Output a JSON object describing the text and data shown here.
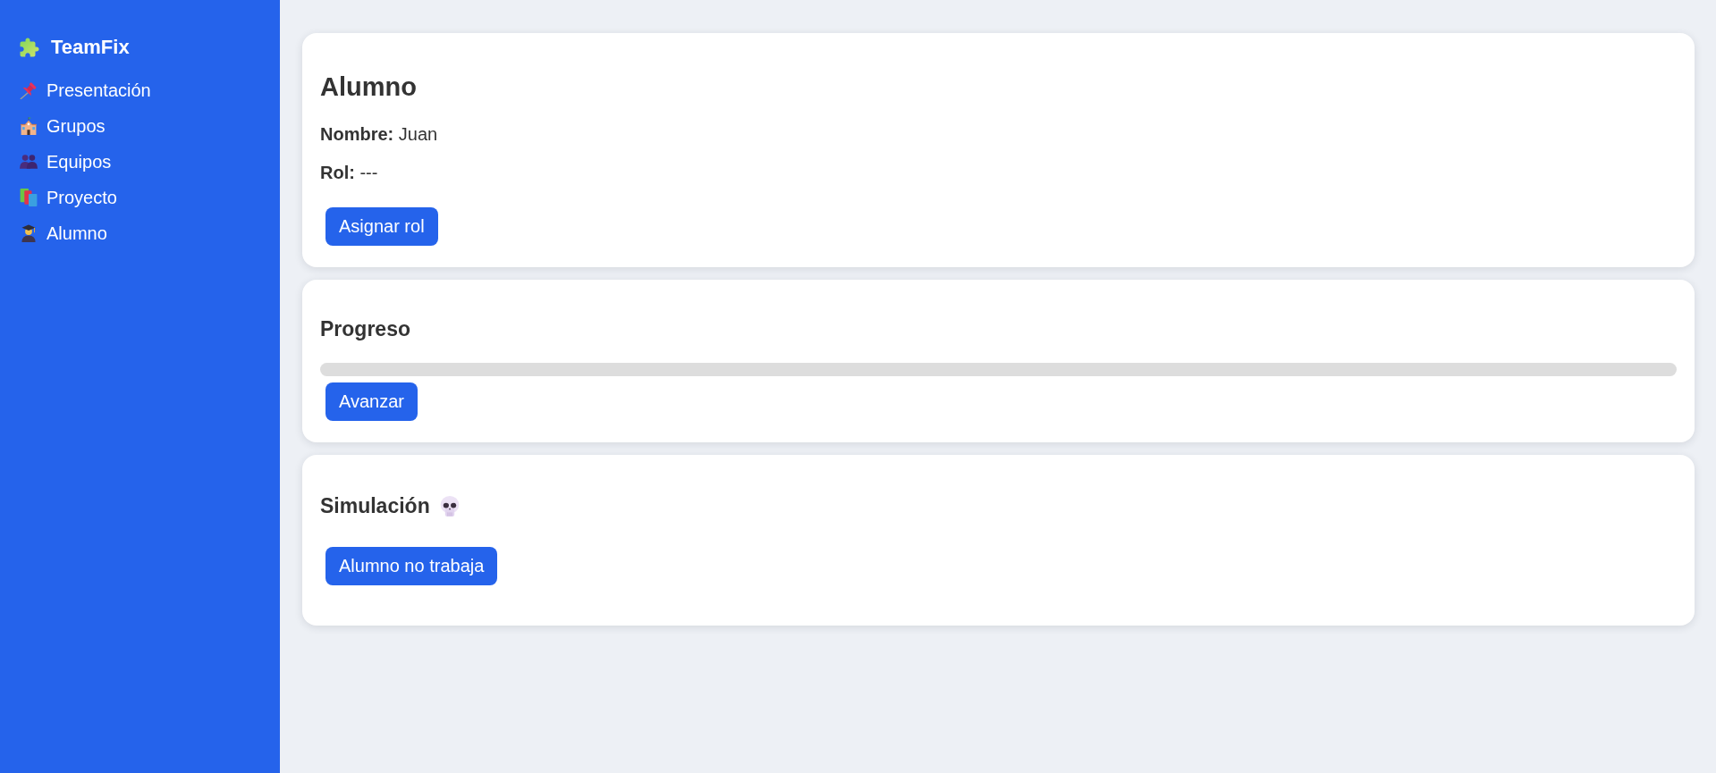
{
  "sidebar": {
    "brand": "TeamFix",
    "items": [
      "Presentación",
      "Grupos",
      "Equipos",
      "Proyecto",
      "Alumno"
    ]
  },
  "cards": [
    {
      "kind": "profile",
      "title": "Alumno",
      "fields": [
        "**Nombre:** Juan",
        "**Rol:** ---"
      ],
      "button": "Asignar rol"
    },
    {
      "kind": "progress",
      "title": "Progreso",
      "level": 0,
      "button": "Avanzar"
    },
    {
      "kind": "simulation",
      "title": "Simulación",
      "button": "Alumno no trabaja"
    }
  ]
}
